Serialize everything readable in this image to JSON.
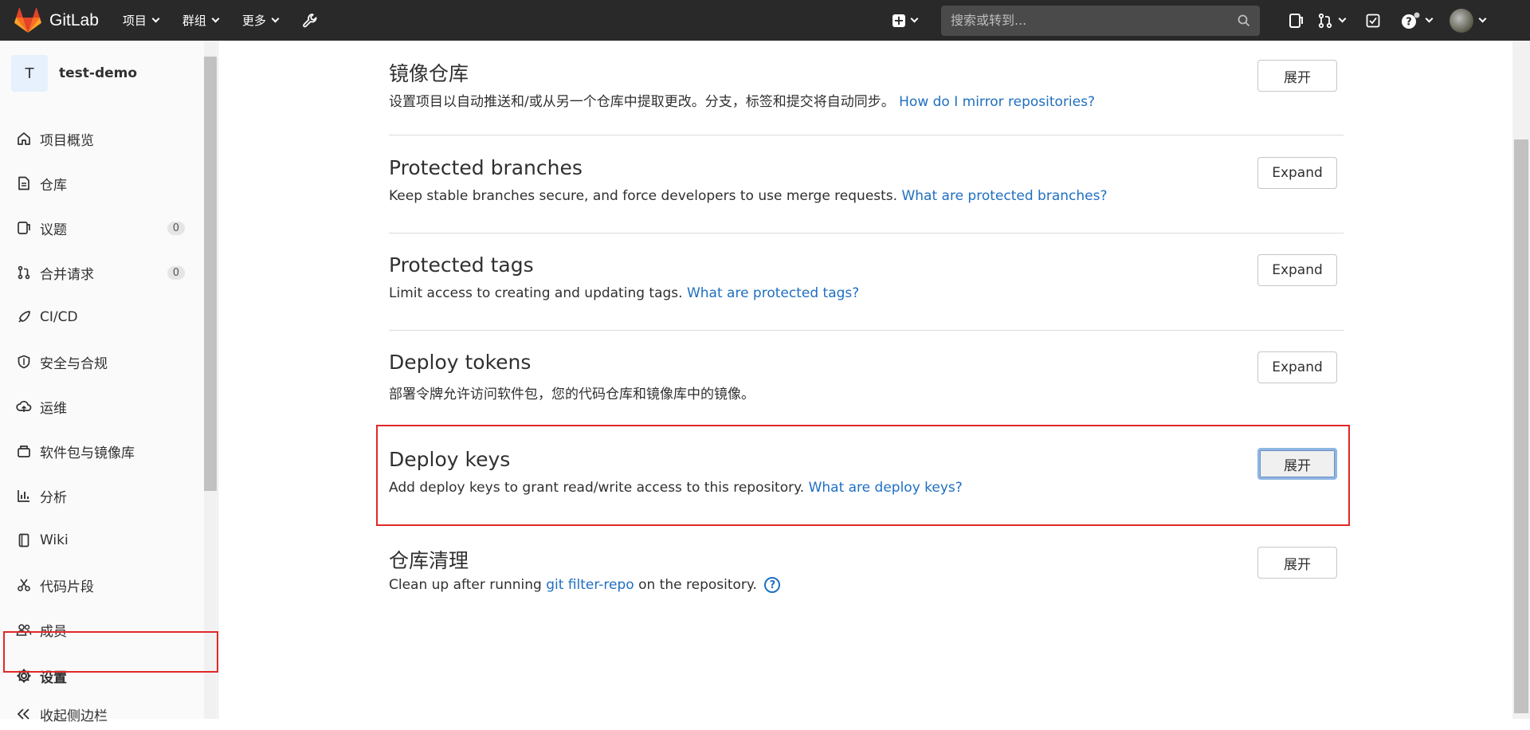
{
  "navbar": {
    "brand": "GitLab",
    "menu": [
      "项目",
      "群组",
      "更多"
    ],
    "search_placeholder": "搜索或转到..."
  },
  "sidebar": {
    "project_initial": "T",
    "project_name": "test-demo",
    "items": [
      {
        "label": "项目概览",
        "icon": "home-icon"
      },
      {
        "label": "仓库",
        "icon": "file-icon"
      },
      {
        "label": "议题",
        "icon": "issues-icon",
        "badge": "0"
      },
      {
        "label": "合并请求",
        "icon": "merge-request-icon",
        "badge": "0"
      },
      {
        "label": "CI/CD",
        "icon": "rocket-icon"
      },
      {
        "label": "安全与合规",
        "icon": "shield-icon"
      },
      {
        "label": "运维",
        "icon": "cloud-icon"
      },
      {
        "label": "软件包与镜像库",
        "icon": "package-icon"
      },
      {
        "label": "分析",
        "icon": "chart-icon"
      },
      {
        "label": "Wiki",
        "icon": "book-icon"
      },
      {
        "label": "代码片段",
        "icon": "scissors-icon"
      },
      {
        "label": "成员",
        "icon": "users-icon"
      },
      {
        "label": "设置",
        "icon": "gear-icon"
      }
    ],
    "collapse_label": "收起侧边栏"
  },
  "sections": [
    {
      "title": "镜像仓库",
      "desc": "设置项目以自动推送和/或从另一个仓库中提取更改。分支，标签和提交将自动同步。 ",
      "link": "How do I mirror repositories?",
      "button": "展开"
    },
    {
      "title": "Protected branches",
      "desc": "Keep stable branches secure, and force developers to use merge requests. ",
      "link": "What are protected branches?",
      "button": "Expand"
    },
    {
      "title": "Protected tags",
      "desc": "Limit access to creating and updating tags. ",
      "link": "What are protected tags?",
      "button": "Expand"
    },
    {
      "title": "Deploy tokens",
      "desc": "部署令牌允许访问软件包，您的代码仓库和镜像库中的镜像。",
      "link": "",
      "button": "Expand"
    },
    {
      "title": "Deploy keys",
      "desc": "Add deploy keys to grant read/write access to this repository. ",
      "link": "What are deploy keys?",
      "button": "展开"
    },
    {
      "title": "仓库清理",
      "desc_before": "Clean up after running ",
      "link": "git filter-repo",
      "desc_after": " on the repository.",
      "button": "展开"
    }
  ]
}
